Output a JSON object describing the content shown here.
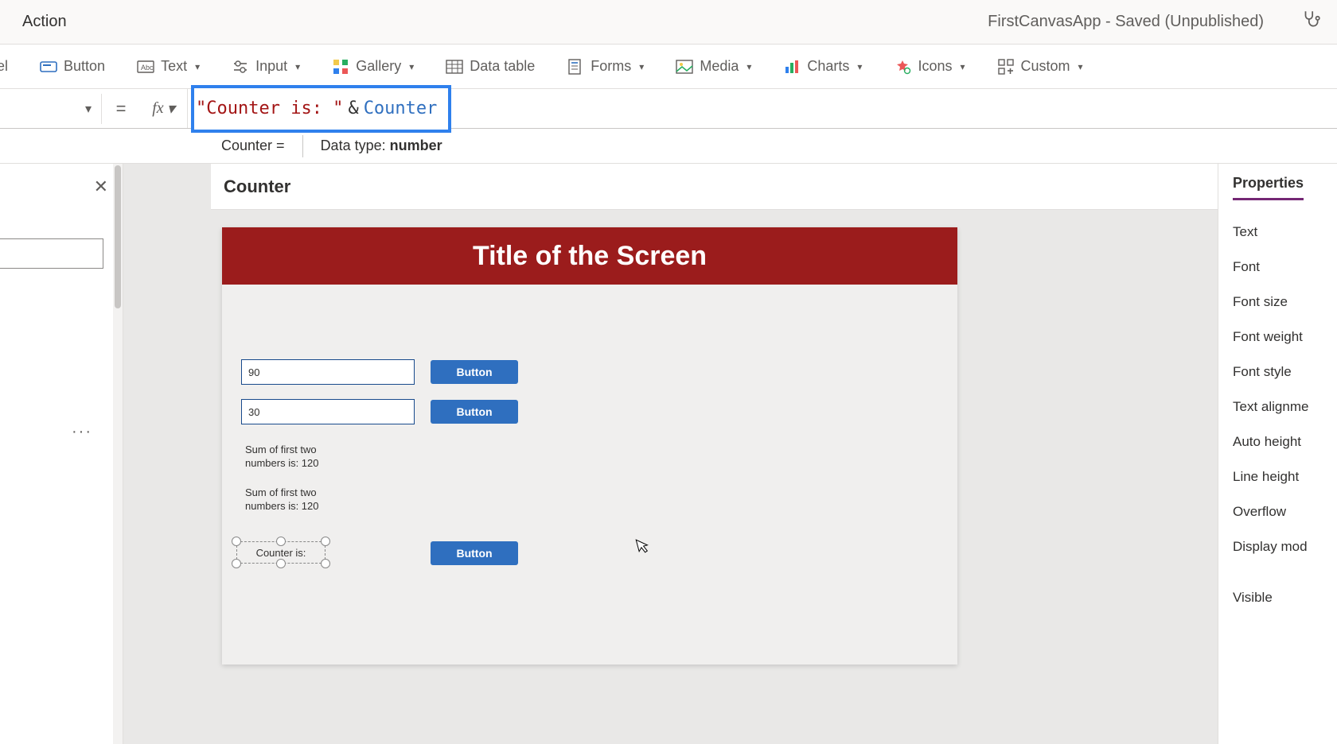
{
  "header": {
    "action_label": "Action",
    "app_title": "FirstCanvasApp - Saved (Unpublished)"
  },
  "ribbon": {
    "label": "el",
    "button": "Button",
    "text": "Text",
    "input": "Input",
    "gallery": "Gallery",
    "data_table": "Data table",
    "forms": "Forms",
    "media": "Media",
    "charts": "Charts",
    "icons": "Icons",
    "custom": "Custom"
  },
  "formula": {
    "equals": "=",
    "fx": "fx",
    "string_part": "\"Counter is: \"",
    "op": "&",
    "var_part": "Counter"
  },
  "intellisense": {
    "var_expr": "Counter  =",
    "dt_label": "Data type: ",
    "dt_value": "number"
  },
  "selected_control": "Counter",
  "canvas": {
    "title": "Title of the Screen",
    "input1": "90",
    "input2": "30",
    "button_label": "Button",
    "sum1": "Sum of first two numbers is: 120",
    "sum2": "Sum of first two numbers is: 120",
    "counter_label": "Counter is:"
  },
  "properties": {
    "tab": "Properties",
    "rows": [
      "Text",
      "Font",
      "Font size",
      "Font weight",
      "Font style",
      "Text alignme",
      "Auto height",
      "Line height",
      "Overflow",
      "Display mod",
      "Visible"
    ]
  }
}
